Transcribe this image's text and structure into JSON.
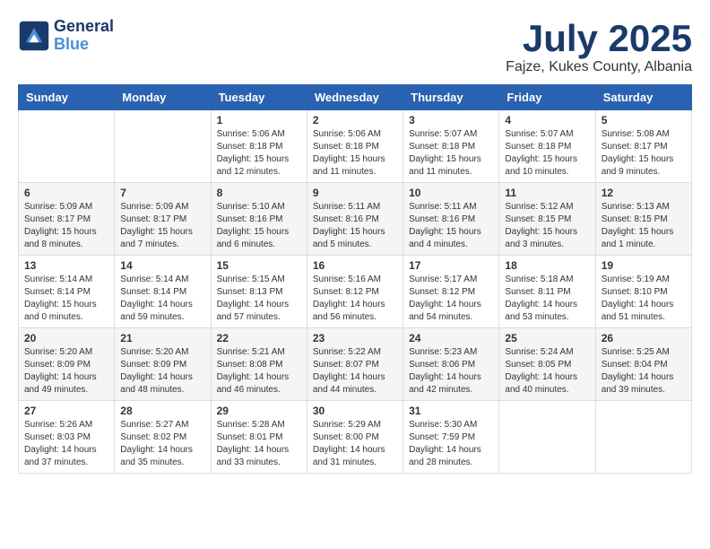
{
  "header": {
    "logo_line1": "General",
    "logo_line2": "Blue",
    "month_title": "July 2025",
    "location": "Fajze, Kukes County, Albania"
  },
  "days_of_week": [
    "Sunday",
    "Monday",
    "Tuesday",
    "Wednesday",
    "Thursday",
    "Friday",
    "Saturday"
  ],
  "weeks": [
    [
      {
        "day": "",
        "info": ""
      },
      {
        "day": "",
        "info": ""
      },
      {
        "day": "1",
        "info": "Sunrise: 5:06 AM\nSunset: 8:18 PM\nDaylight: 15 hours and 12 minutes."
      },
      {
        "day": "2",
        "info": "Sunrise: 5:06 AM\nSunset: 8:18 PM\nDaylight: 15 hours and 11 minutes."
      },
      {
        "day": "3",
        "info": "Sunrise: 5:07 AM\nSunset: 8:18 PM\nDaylight: 15 hours and 11 minutes."
      },
      {
        "day": "4",
        "info": "Sunrise: 5:07 AM\nSunset: 8:18 PM\nDaylight: 15 hours and 10 minutes."
      },
      {
        "day": "5",
        "info": "Sunrise: 5:08 AM\nSunset: 8:17 PM\nDaylight: 15 hours and 9 minutes."
      }
    ],
    [
      {
        "day": "6",
        "info": "Sunrise: 5:09 AM\nSunset: 8:17 PM\nDaylight: 15 hours and 8 minutes."
      },
      {
        "day": "7",
        "info": "Sunrise: 5:09 AM\nSunset: 8:17 PM\nDaylight: 15 hours and 7 minutes."
      },
      {
        "day": "8",
        "info": "Sunrise: 5:10 AM\nSunset: 8:16 PM\nDaylight: 15 hours and 6 minutes."
      },
      {
        "day": "9",
        "info": "Sunrise: 5:11 AM\nSunset: 8:16 PM\nDaylight: 15 hours and 5 minutes."
      },
      {
        "day": "10",
        "info": "Sunrise: 5:11 AM\nSunset: 8:16 PM\nDaylight: 15 hours and 4 minutes."
      },
      {
        "day": "11",
        "info": "Sunrise: 5:12 AM\nSunset: 8:15 PM\nDaylight: 15 hours and 3 minutes."
      },
      {
        "day": "12",
        "info": "Sunrise: 5:13 AM\nSunset: 8:15 PM\nDaylight: 15 hours and 1 minute."
      }
    ],
    [
      {
        "day": "13",
        "info": "Sunrise: 5:14 AM\nSunset: 8:14 PM\nDaylight: 15 hours and 0 minutes."
      },
      {
        "day": "14",
        "info": "Sunrise: 5:14 AM\nSunset: 8:14 PM\nDaylight: 14 hours and 59 minutes."
      },
      {
        "day": "15",
        "info": "Sunrise: 5:15 AM\nSunset: 8:13 PM\nDaylight: 14 hours and 57 minutes."
      },
      {
        "day": "16",
        "info": "Sunrise: 5:16 AM\nSunset: 8:12 PM\nDaylight: 14 hours and 56 minutes."
      },
      {
        "day": "17",
        "info": "Sunrise: 5:17 AM\nSunset: 8:12 PM\nDaylight: 14 hours and 54 minutes."
      },
      {
        "day": "18",
        "info": "Sunrise: 5:18 AM\nSunset: 8:11 PM\nDaylight: 14 hours and 53 minutes."
      },
      {
        "day": "19",
        "info": "Sunrise: 5:19 AM\nSunset: 8:10 PM\nDaylight: 14 hours and 51 minutes."
      }
    ],
    [
      {
        "day": "20",
        "info": "Sunrise: 5:20 AM\nSunset: 8:09 PM\nDaylight: 14 hours and 49 minutes."
      },
      {
        "day": "21",
        "info": "Sunrise: 5:20 AM\nSunset: 8:09 PM\nDaylight: 14 hours and 48 minutes."
      },
      {
        "day": "22",
        "info": "Sunrise: 5:21 AM\nSunset: 8:08 PM\nDaylight: 14 hours and 46 minutes."
      },
      {
        "day": "23",
        "info": "Sunrise: 5:22 AM\nSunset: 8:07 PM\nDaylight: 14 hours and 44 minutes."
      },
      {
        "day": "24",
        "info": "Sunrise: 5:23 AM\nSunset: 8:06 PM\nDaylight: 14 hours and 42 minutes."
      },
      {
        "day": "25",
        "info": "Sunrise: 5:24 AM\nSunset: 8:05 PM\nDaylight: 14 hours and 40 minutes."
      },
      {
        "day": "26",
        "info": "Sunrise: 5:25 AM\nSunset: 8:04 PM\nDaylight: 14 hours and 39 minutes."
      }
    ],
    [
      {
        "day": "27",
        "info": "Sunrise: 5:26 AM\nSunset: 8:03 PM\nDaylight: 14 hours and 37 minutes."
      },
      {
        "day": "28",
        "info": "Sunrise: 5:27 AM\nSunset: 8:02 PM\nDaylight: 14 hours and 35 minutes."
      },
      {
        "day": "29",
        "info": "Sunrise: 5:28 AM\nSunset: 8:01 PM\nDaylight: 14 hours and 33 minutes."
      },
      {
        "day": "30",
        "info": "Sunrise: 5:29 AM\nSunset: 8:00 PM\nDaylight: 14 hours and 31 minutes."
      },
      {
        "day": "31",
        "info": "Sunrise: 5:30 AM\nSunset: 7:59 PM\nDaylight: 14 hours and 28 minutes."
      },
      {
        "day": "",
        "info": ""
      },
      {
        "day": "",
        "info": ""
      }
    ]
  ]
}
